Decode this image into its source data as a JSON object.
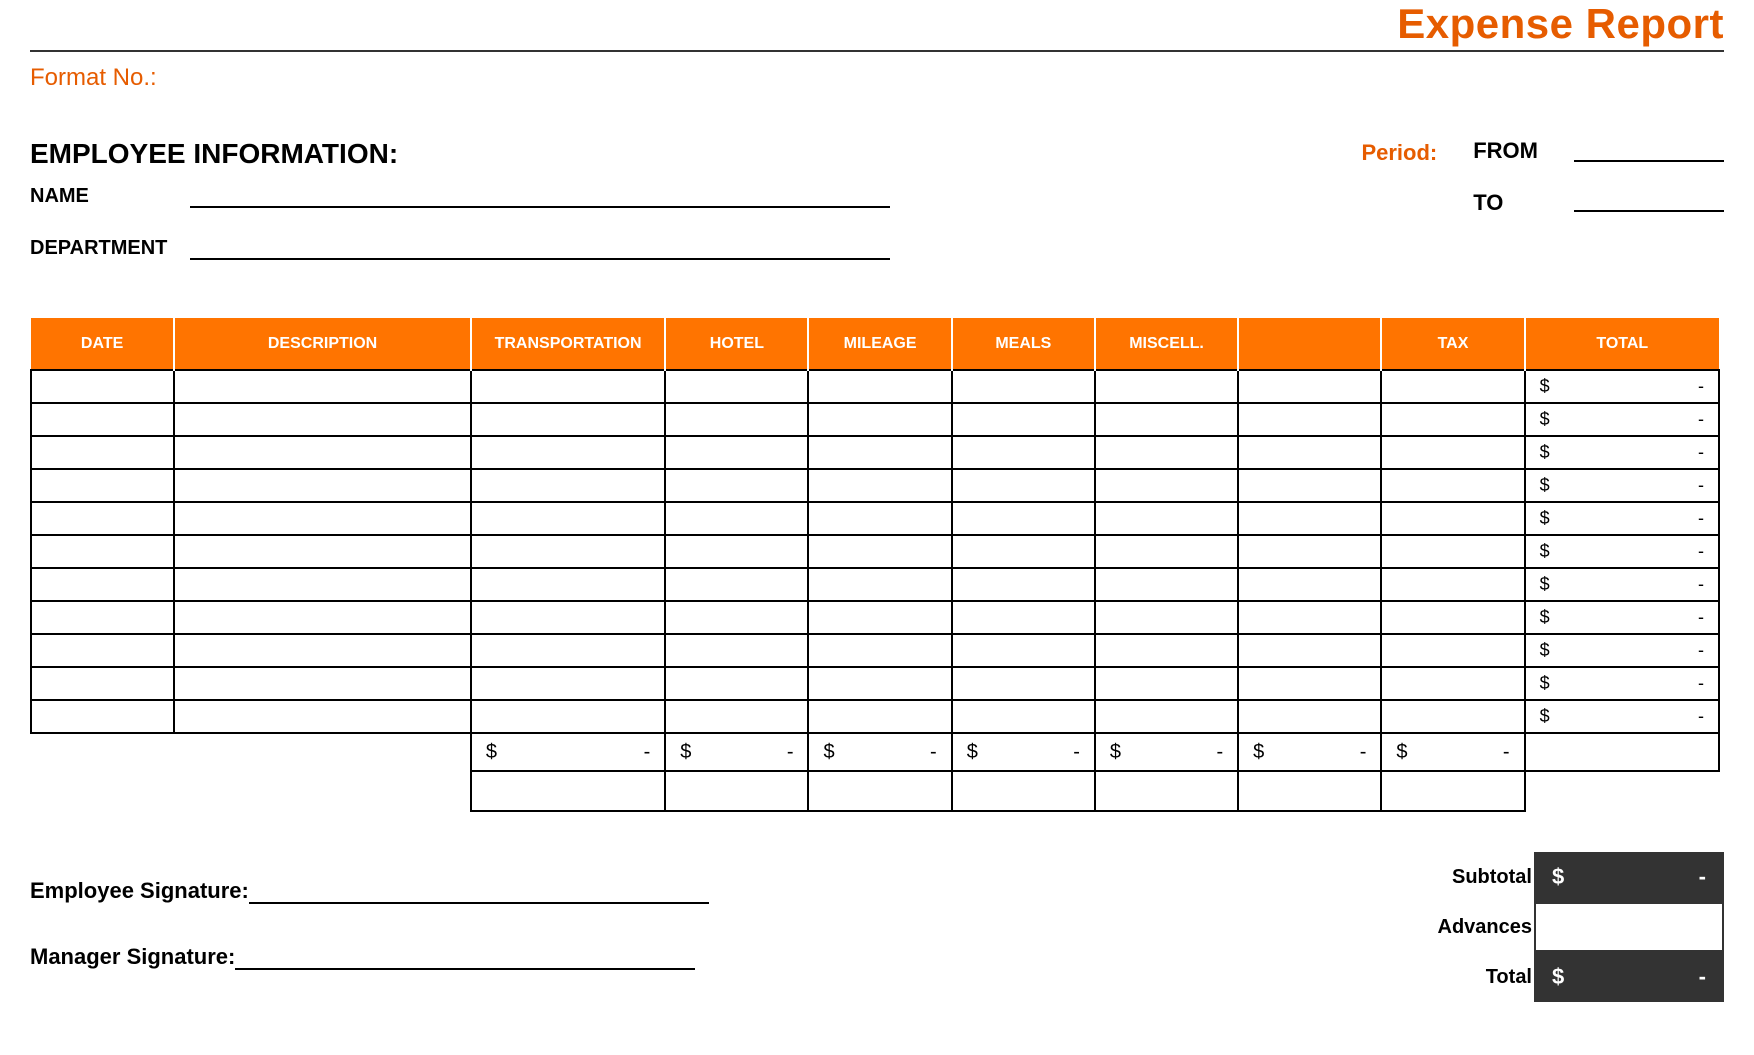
{
  "title": "Expense Report",
  "format_no_label": "Format No.:",
  "employee_info_heading": "EMPLOYEE INFORMATION:",
  "name_label": "NAME",
  "department_label": "DEPARTMENT",
  "period_label": "Period:",
  "from_label": "FROM",
  "to_label": "TO",
  "columns": {
    "date": "DATE",
    "description": "DESCRIPTION",
    "transportation": "TRANSPORTATION",
    "hotel": "HOTEL",
    "mileage": "MILEAGE",
    "meals": "MEALS",
    "misc": "MISCELL.",
    "blank": "",
    "tax": "TAX",
    "total": "TOTAL"
  },
  "rows": [
    {
      "date": "",
      "description": "",
      "transportation": "",
      "hotel": "",
      "mileage": "",
      "meals": "",
      "misc": "",
      "blank": "",
      "tax": "",
      "total_sym": "$",
      "total_val": "-"
    },
    {
      "date": "",
      "description": "",
      "transportation": "",
      "hotel": "",
      "mileage": "",
      "meals": "",
      "misc": "",
      "blank": "",
      "tax": "",
      "total_sym": "$",
      "total_val": "-"
    },
    {
      "date": "",
      "description": "",
      "transportation": "",
      "hotel": "",
      "mileage": "",
      "meals": "",
      "misc": "",
      "blank": "",
      "tax": "",
      "total_sym": "$",
      "total_val": "-"
    },
    {
      "date": "",
      "description": "",
      "transportation": "",
      "hotel": "",
      "mileage": "",
      "meals": "",
      "misc": "",
      "blank": "",
      "tax": "",
      "total_sym": "$",
      "total_val": "-"
    },
    {
      "date": "",
      "description": "",
      "transportation": "",
      "hotel": "",
      "mileage": "",
      "meals": "",
      "misc": "",
      "blank": "",
      "tax": "",
      "total_sym": "$",
      "total_val": "-"
    },
    {
      "date": "",
      "description": "",
      "transportation": "",
      "hotel": "",
      "mileage": "",
      "meals": "",
      "misc": "",
      "blank": "",
      "tax": "",
      "total_sym": "$",
      "total_val": "-"
    },
    {
      "date": "",
      "description": "",
      "transportation": "",
      "hotel": "",
      "mileage": "",
      "meals": "",
      "misc": "",
      "blank": "",
      "tax": "",
      "total_sym": "$",
      "total_val": "-"
    },
    {
      "date": "",
      "description": "",
      "transportation": "",
      "hotel": "",
      "mileage": "",
      "meals": "",
      "misc": "",
      "blank": "",
      "tax": "",
      "total_sym": "$",
      "total_val": "-"
    },
    {
      "date": "",
      "description": "",
      "transportation": "",
      "hotel": "",
      "mileage": "",
      "meals": "",
      "misc": "",
      "blank": "",
      "tax": "",
      "total_sym": "$",
      "total_val": "-"
    },
    {
      "date": "",
      "description": "",
      "transportation": "",
      "hotel": "",
      "mileage": "",
      "meals": "",
      "misc": "",
      "blank": "",
      "tax": "",
      "total_sym": "$",
      "total_val": "-"
    },
    {
      "date": "",
      "description": "",
      "transportation": "",
      "hotel": "",
      "mileage": "",
      "meals": "",
      "misc": "",
      "blank": "",
      "tax": "",
      "total_sym": "$",
      "total_val": "-"
    }
  ],
  "column_sums": {
    "transportation": {
      "sym": "$",
      "val": "-"
    },
    "hotel": {
      "sym": "$",
      "val": "-"
    },
    "mileage": {
      "sym": "$",
      "val": "-"
    },
    "meals": {
      "sym": "$",
      "val": "-"
    },
    "misc": {
      "sym": "$",
      "val": "-"
    },
    "blank": {
      "sym": "$",
      "val": "-"
    },
    "tax": {
      "sym": "$",
      "val": "-"
    }
  },
  "signatures": {
    "employee": "Employee Signature:",
    "manager": "Manager Signature:"
  },
  "totals": {
    "subtotal_label": "Subtotal",
    "subtotal": {
      "sym": "$",
      "val": "-"
    },
    "advances_label": "Advances",
    "advances": "",
    "total_label": "Total",
    "total": {
      "sym": "$",
      "val": "-"
    }
  }
}
